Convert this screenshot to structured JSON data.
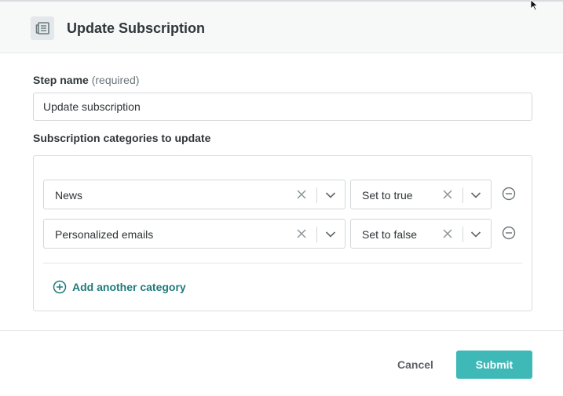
{
  "header": {
    "title": "Update Subscription",
    "icon": "newspaper-icon"
  },
  "step_name": {
    "label": "Step name",
    "hint": "(required)",
    "value": "Update subscription"
  },
  "categories": {
    "label": "Subscription categories to update",
    "rows": [
      {
        "category": "News",
        "action": "Set to true"
      },
      {
        "category": "Personalized emails",
        "action": "Set to false"
      }
    ],
    "add_label": "Add another category"
  },
  "footer": {
    "cancel_label": "Cancel",
    "submit_label": "Submit"
  },
  "colors": {
    "accent": "#3fb8b8",
    "link": "#1f7a7a",
    "header_bg": "#f7f8f8"
  }
}
